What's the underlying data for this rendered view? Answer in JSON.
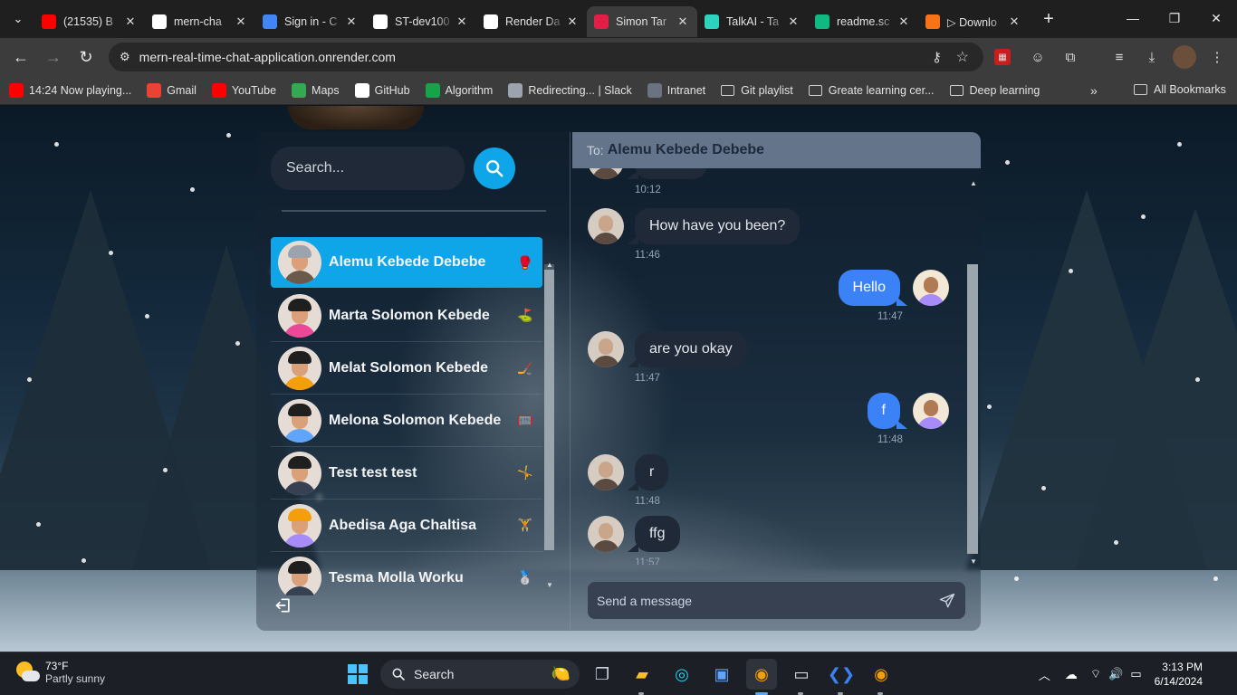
{
  "browser": {
    "tabs": [
      {
        "title": "(21535) B",
        "icon": "youtube-icon",
        "color": "#ff0000",
        "active": false
      },
      {
        "title": "mern-cha",
        "icon": "github-icon",
        "color": "#ffffff",
        "active": false
      },
      {
        "title": "Sign in - C",
        "icon": "google-icon",
        "color": "#4285f4",
        "active": false
      },
      {
        "title": "ST-dev100",
        "icon": "github-icon",
        "color": "#ffffff",
        "active": false
      },
      {
        "title": "Render Da",
        "icon": "render-icon",
        "color": "#ffffff",
        "active": false
      },
      {
        "title": "Simon Tar",
        "icon": "app-icon",
        "color": "#e11d48",
        "active": true
      },
      {
        "title": "TalkAI - Ta",
        "icon": "talkai-icon",
        "color": "#2dd4bf",
        "active": false
      },
      {
        "title": "readme.sc",
        "icon": "readme-icon",
        "color": "#10b981",
        "active": false
      },
      {
        "title": "▷ Downlo",
        "icon": "download-tab-icon",
        "color": "#f97316",
        "active": false
      }
    ],
    "url": "mern-real-time-chat-application.onrender.com",
    "bookmarks": [
      {
        "label": "14:24 Now playing...",
        "icon": "youtube-icon",
        "color": "#ff0000"
      },
      {
        "label": "Gmail",
        "icon": "gmail-icon",
        "color": "#ea4335"
      },
      {
        "label": "YouTube",
        "icon": "youtube-icon",
        "color": "#ff0000"
      },
      {
        "label": "Maps",
        "icon": "maps-icon",
        "color": "#34a853"
      },
      {
        "label": "GitHub",
        "icon": "github-icon",
        "color": "#ffffff"
      },
      {
        "label": "Algorithm",
        "icon": "algorithm-icon",
        "color": "#16a34a"
      },
      {
        "label": "Redirecting... | Slack",
        "icon": "globe-icon",
        "color": "#9ca3af"
      },
      {
        "label": "Intranet",
        "icon": "intranet-icon",
        "color": "#6b7280"
      },
      {
        "label": "Git playlist",
        "icon": "folder-icon",
        "color": ""
      },
      {
        "label": "Greate learning cer...",
        "icon": "folder-icon",
        "color": ""
      },
      {
        "label": "Deep learning",
        "icon": "folder-icon",
        "color": ""
      }
    ],
    "all_bookmarks": "All Bookmarks"
  },
  "sidebar": {
    "search_placeholder": "Search...",
    "conversations": [
      {
        "name": "Alemu Kebede Debebe",
        "emoji": "🥊",
        "selected": true,
        "hair": "#9ca3af",
        "body": "#6b5a4c"
      },
      {
        "name": "Marta Solomon Kebede",
        "emoji": "⛳",
        "selected": false,
        "hair": "#1f1f1f",
        "body": "#ec4899"
      },
      {
        "name": "Melat Solomon Kebede",
        "emoji": "🏒",
        "selected": false,
        "hair": "#1f1f1f",
        "body": "#f59e0b"
      },
      {
        "name": "Melona Solomon Kebede",
        "emoji": "🥅",
        "selected": false,
        "hair": "#1f1f1f",
        "body": "#60a5fa"
      },
      {
        "name": "Test test test",
        "emoji": "🤸",
        "selected": false,
        "hair": "#1f1f1f",
        "body": "#374151"
      },
      {
        "name": "Abedisa Aga Chaltisa",
        "emoji": "🏋",
        "selected": false,
        "hair": "#f59e0b",
        "body": "#a78bfa"
      },
      {
        "name": "Tesma Molla Worku",
        "emoji": "🥈",
        "selected": false,
        "hair": "#1f1f1f",
        "body": "#374151"
      }
    ]
  },
  "chat": {
    "to_label": "To:",
    "recipient": "Alemu Kebede Debebe",
    "messages": [
      {
        "text": "",
        "time": "10:12",
        "from": "them"
      },
      {
        "text": "How have you been?",
        "time": "11:46",
        "from": "them"
      },
      {
        "text": "Hello",
        "time": "11:47",
        "from": "me"
      },
      {
        "text": "are you okay",
        "time": "11:47",
        "from": "them"
      },
      {
        "text": "f",
        "time": "11:48",
        "from": "me"
      },
      {
        "text": "r",
        "time": "11:48",
        "from": "them"
      },
      {
        "text": "ffg",
        "time": "11:57",
        "from": "them"
      }
    ],
    "input_placeholder": "Send a message"
  },
  "taskbar": {
    "weather_temp": "73°F",
    "weather_text": "Partly sunny",
    "search_label": "Search",
    "time": "3:13 PM",
    "date": "6/14/2024"
  },
  "colors": {
    "accent": "#0ea5e9",
    "outgoing_bubble": "#3b82f6",
    "incoming_bubble": "#1f2937",
    "chat_header": "#64748b"
  }
}
